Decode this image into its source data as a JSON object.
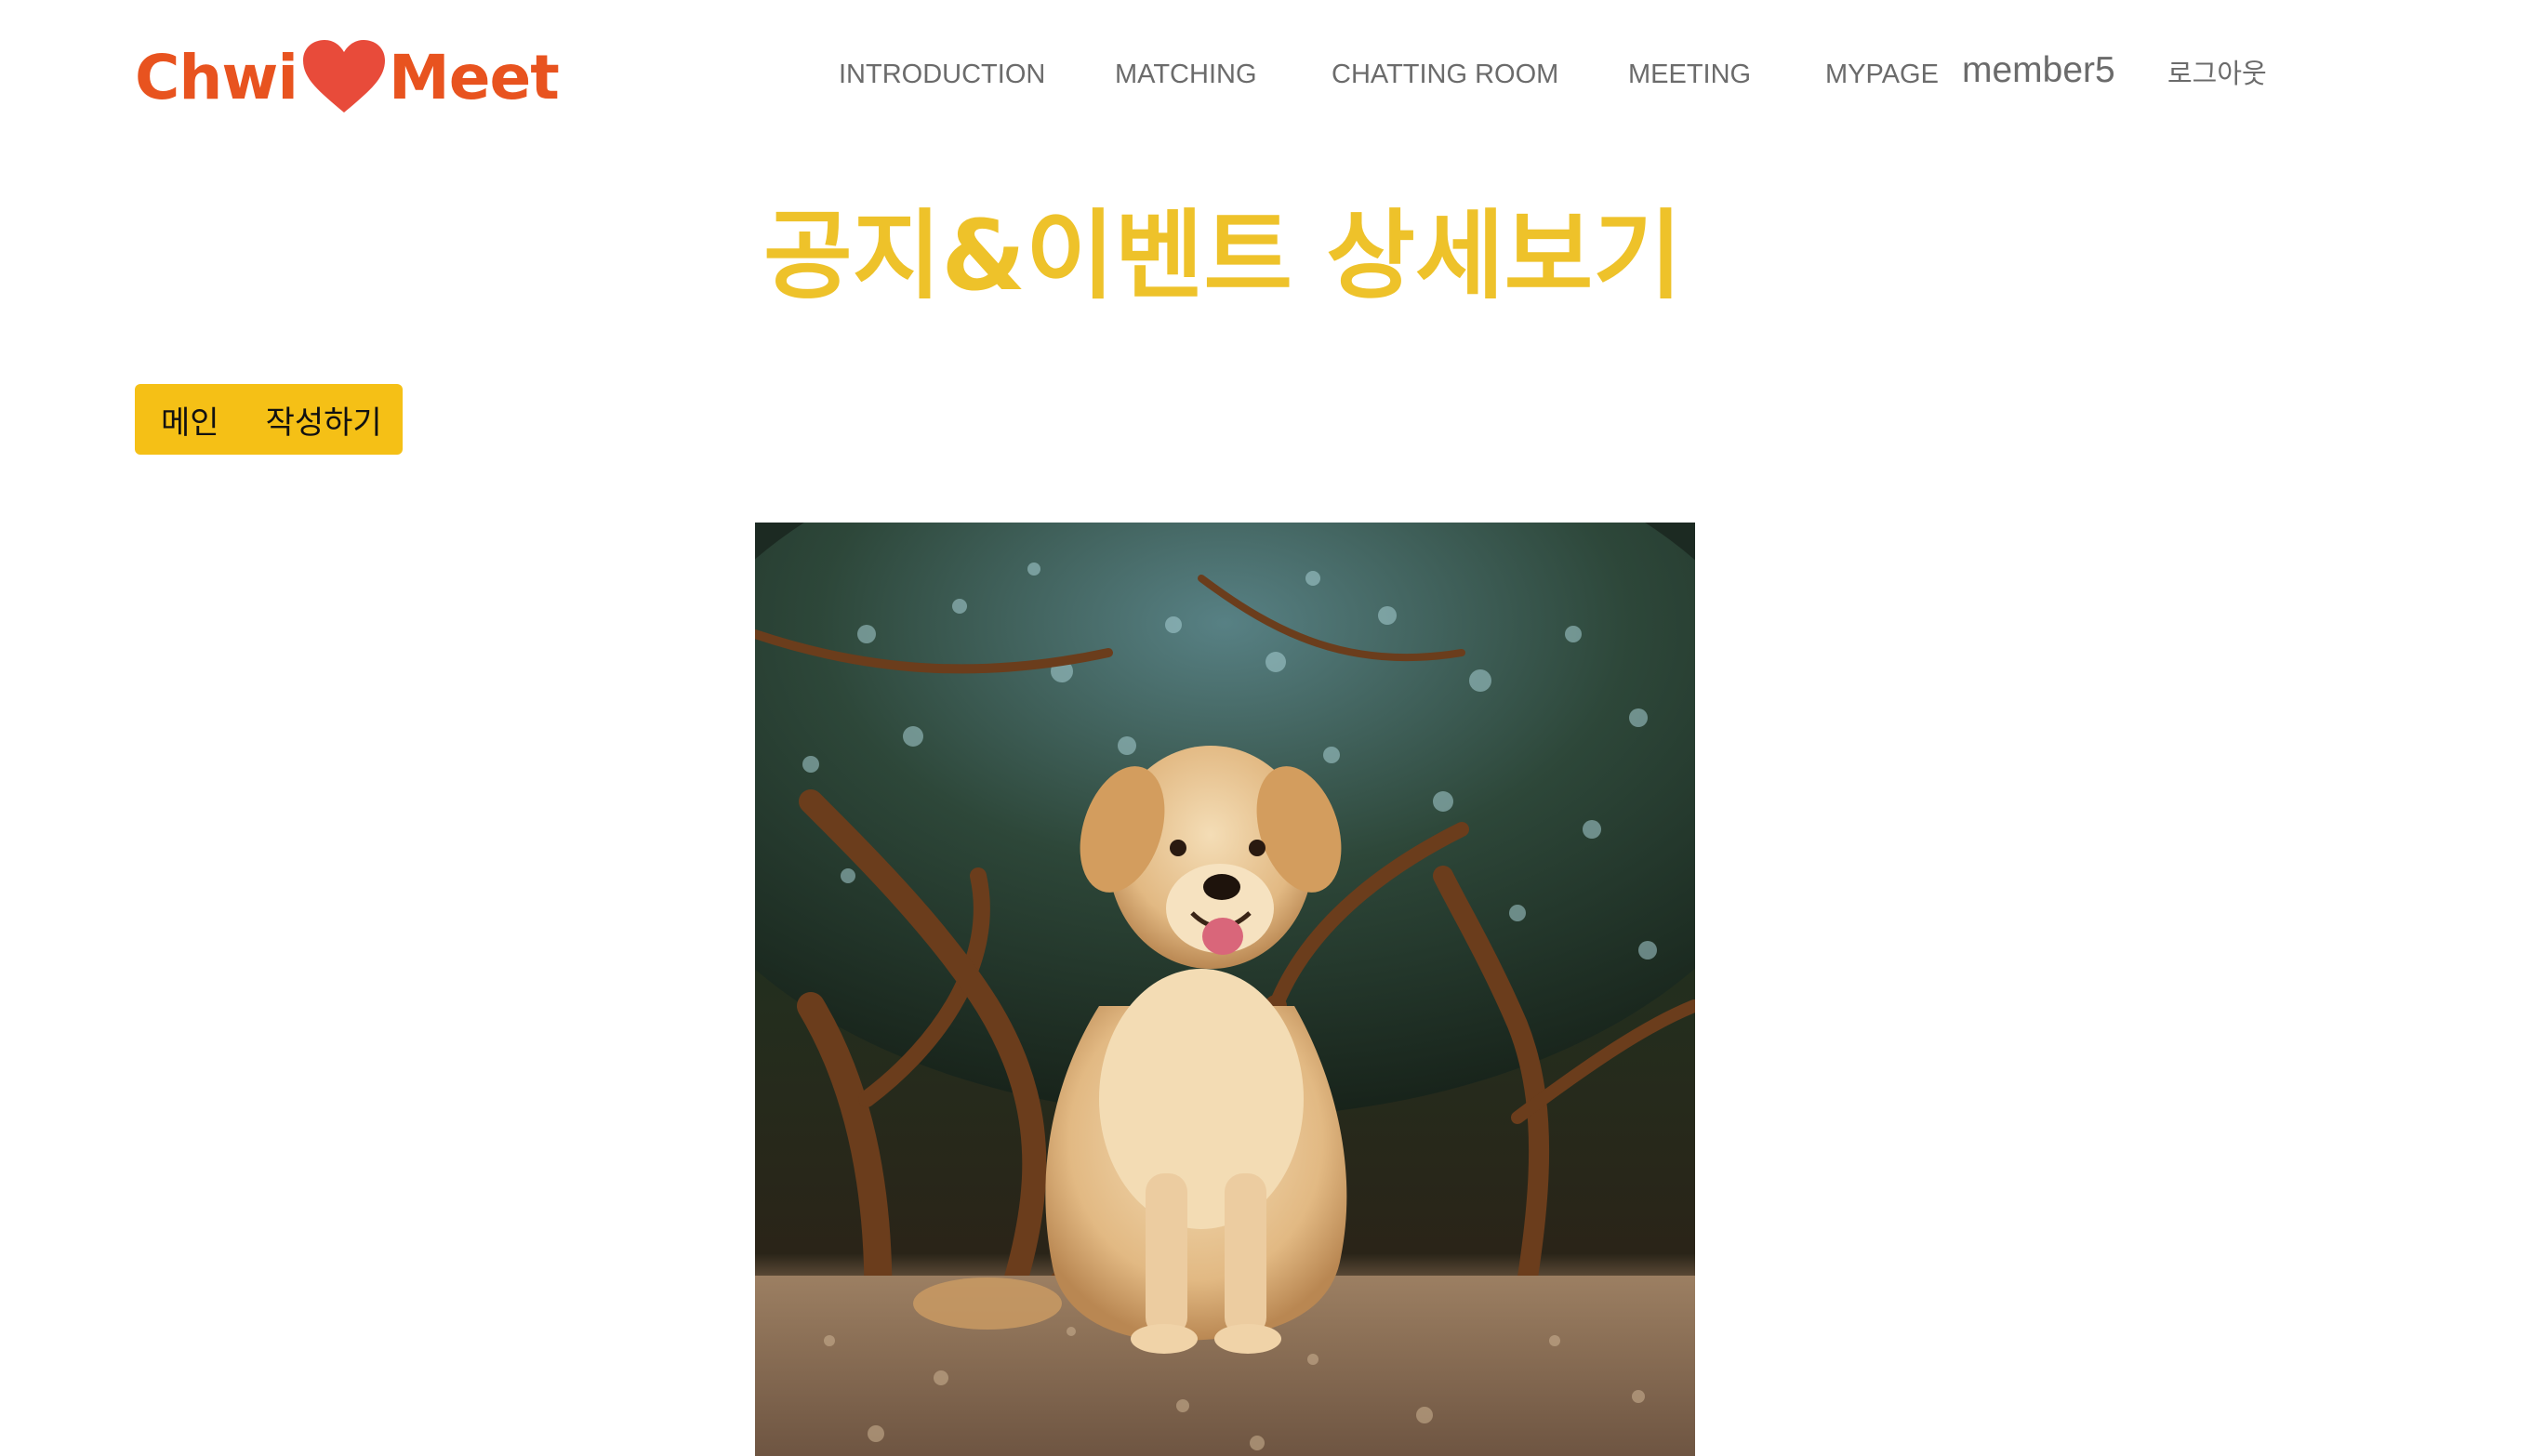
{
  "header": {
    "logo": {
      "part1": "Chwi",
      "part2": "Meet",
      "icon": "heart-icon",
      "color": "#e8531f",
      "heart_color": "#e84b3a"
    },
    "nav": [
      {
        "label": "INTRODUCTION"
      },
      {
        "label": "MATCHING"
      },
      {
        "label": "CHATTING ROOM"
      },
      {
        "label": "MEETING"
      },
      {
        "label": "MYPAGE"
      }
    ],
    "username": "member5",
    "logout_label": "로그아웃"
  },
  "main": {
    "title": "공지&이벤트 상세보기",
    "title_color": "#eec22a",
    "buttons": {
      "main_label": "메인",
      "write_label": "작성하기",
      "color": "#f5c016"
    },
    "image": {
      "alt": "golden retriever sitting under trees"
    }
  }
}
